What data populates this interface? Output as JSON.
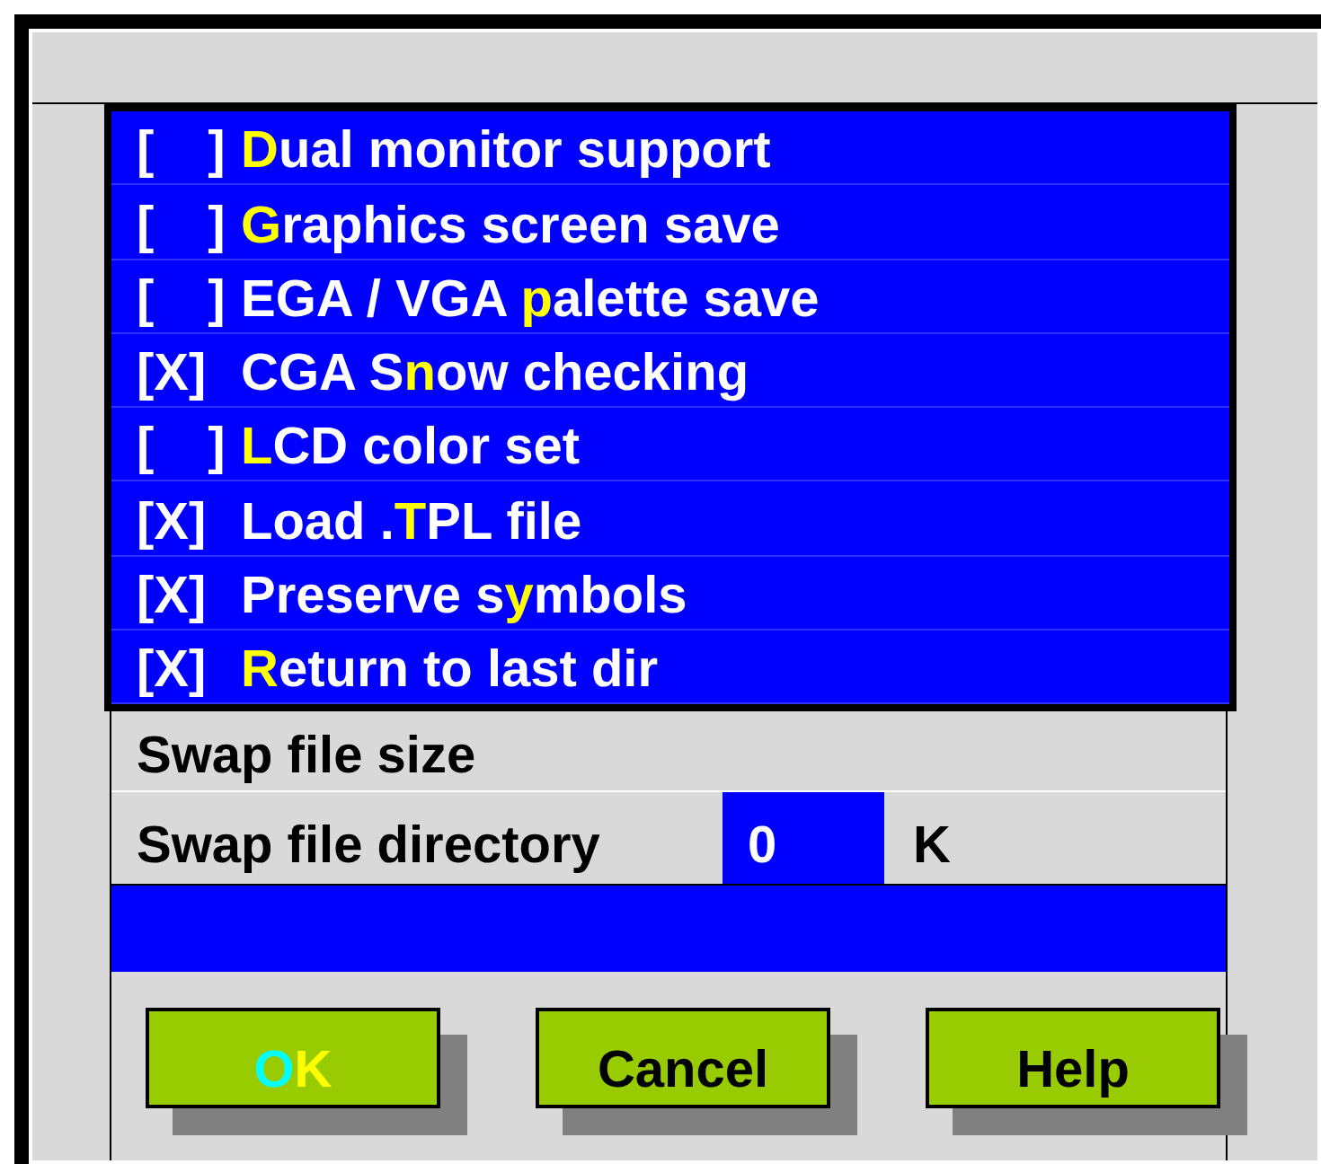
{
  "options": [
    {
      "checked": false,
      "box_open": "[",
      "box_close": "]",
      "hotkey": "D",
      "after": "ual monitor support"
    },
    {
      "checked": false,
      "box_open": "[",
      "box_close": "]",
      "hotkey": "G",
      "after": "raphics screen save"
    },
    {
      "checked": false,
      "box_open": "[",
      "box_close": "]",
      "before": "EGA / VGA ",
      "hotkey": "p",
      "after": "alette save"
    },
    {
      "checked": true,
      "box_open": "[",
      "mark": "X",
      "box_close": "]",
      "before": "CGA S",
      "hotkey": "n",
      "after": "ow checking"
    },
    {
      "checked": false,
      "box_open": "[",
      "box_close": "]",
      "hotkey": "L",
      "after": "CD color set"
    },
    {
      "checked": true,
      "box_open": "[",
      "mark": "X",
      "box_close": "]",
      "before": "Load .",
      "hotkey": "T",
      "after": "PL file"
    },
    {
      "checked": true,
      "box_open": "[",
      "mark": "X",
      "box_close": "]",
      "before": "Preserve s",
      "hotkey": "y",
      "after": "mbols"
    },
    {
      "checked": true,
      "box_open": "[",
      "mark": "X",
      "box_close": "]",
      "hotkey": "R",
      "after": "eturn to last dir"
    }
  ],
  "swap_size_label": "Swap file size",
  "swap_dir_label": "Swap file directory",
  "swap_value": "0",
  "swap_unit": "K",
  "buttons": [
    {
      "parts": [
        {
          "text": "O",
          "color": "#00ffff"
        },
        {
          "text": "K",
          "color": "#ffff00"
        }
      ]
    },
    {
      "parts": [
        {
          "text": "Cancel",
          "color": "#000000"
        }
      ]
    },
    {
      "parts": [
        {
          "text": "Help",
          "color": "#000000"
        }
      ]
    }
  ]
}
